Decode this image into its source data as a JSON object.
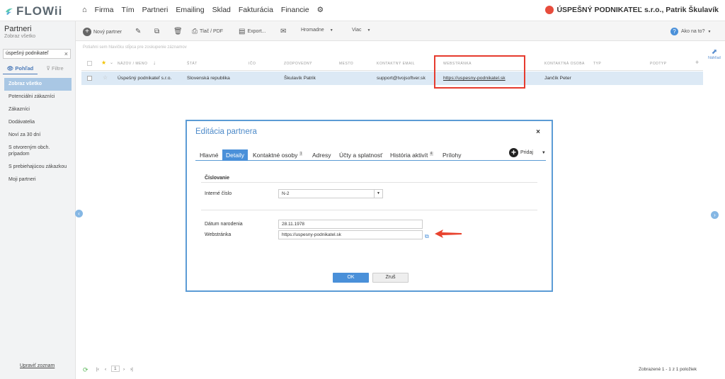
{
  "app": {
    "logo": "FLOWii",
    "user": "ÚSPEŠNÝ PODNIKATEĽ s.r.o., Patrik Škulavík"
  },
  "nav": [
    "Firma",
    "Tím",
    "Partneri",
    "Emailing",
    "Sklad",
    "Fakturácia",
    "Financie"
  ],
  "sidebar": {
    "title": "Partneri",
    "subtitle": "Zobraz všetko",
    "search_value": "úspešný podnikateľ",
    "tabs": [
      "Pohľad",
      "Filtre"
    ],
    "items": [
      "Zobraz všetko",
      "Potenciálni zákazníci",
      "Zákazníci",
      "Dodávatelia",
      "Noví za 30 dní",
      "S otvoreným obch. prípadom",
      "S prebiehajúcou zákazkou",
      "Moji partneri"
    ],
    "footer": "Upraviť zoznam"
  },
  "toolbar": {
    "new": "Nový partner",
    "print": "Tlač / PDF",
    "export": "Export...",
    "bulk": "Hromadne",
    "more": "Viac",
    "help": "Ako na to?"
  },
  "hint": "Potiahni sem hlavičku stĺpca pre zoskupenie záznamov",
  "grid": {
    "headers": [
      "NÁZOV / MENO",
      "ŠTÁT",
      "IČO",
      "ZODPOVEDNÝ",
      "MESTO",
      "KONTAKTNÝ EMAIL",
      "WEBSTRÁNKA",
      "KONTAKTNÁ OSOBA",
      "TYP",
      "PODTYP"
    ],
    "row": {
      "name": "Úspešný podnikateľ s.r.o.",
      "country": "Slovenská republika",
      "responsible": "Škulavík Patrik",
      "email": "support@tvojsoftver.sk",
      "web": "https://uspesny-podnikatel.sk",
      "contact": "Jančík Peter"
    }
  },
  "nahlad": "Náhľad",
  "footer": {
    "page": "1",
    "status": "Zobrazené 1 - 1 z 1 položiek"
  },
  "modal": {
    "title": "Editácia partnera",
    "tabs": [
      "Hlavné",
      "Detaily",
      "Kontaktné osoby",
      "Adresy",
      "Účty a splatnosť",
      "História aktivít",
      "Prílohy"
    ],
    "tab_badges": {
      "contacts": "1",
      "history": "4"
    },
    "add": "Pridaj",
    "section": "Číslovanie",
    "internal_label": "Interné číslo",
    "internal_value": "N-2",
    "birth_label": "Dátum narodenia",
    "birth_value": "28.11.1978",
    "web_label": "Webstránka",
    "web_value": "https://uspesny-podnikatel.sk",
    "ok": "OK",
    "cancel": "Zruš"
  }
}
